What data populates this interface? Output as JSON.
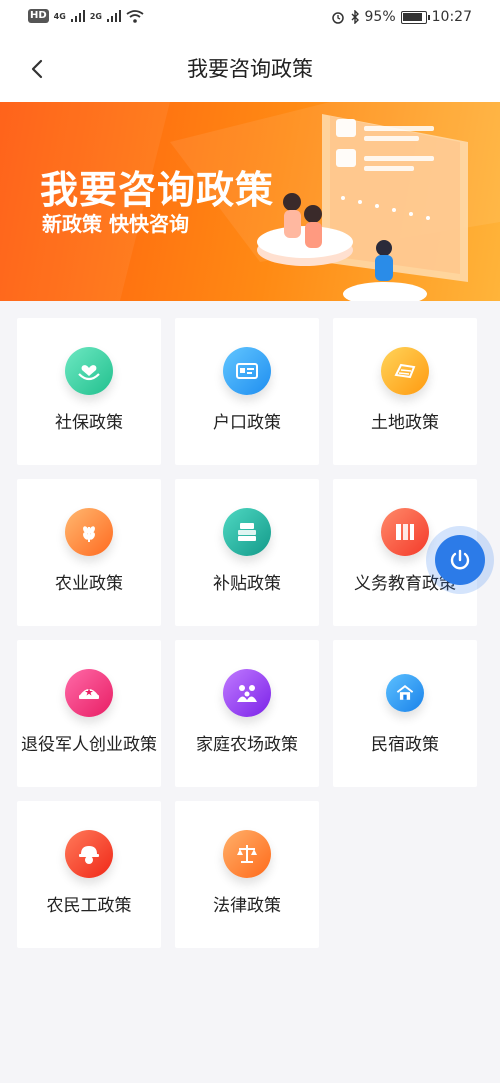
{
  "status_bar": {
    "hd": "HD",
    "net1": "4G",
    "net2": "2G",
    "battery": "95%",
    "time": "10:27"
  },
  "nav": {
    "title": "我要咨询政策"
  },
  "banner": {
    "title": "我要咨询政策",
    "subtitle": "新政策 快快咨询"
  },
  "policies": [
    {
      "label": "社保政策",
      "icon": "heart-hands-icon",
      "color": "#3fd2a0"
    },
    {
      "label": "户口政策",
      "icon": "id-card-icon",
      "color": "#2fa6f5"
    },
    {
      "label": "土地政策",
      "icon": "land-icon",
      "color": "#ffb22a"
    },
    {
      "label": "农业政策",
      "icon": "wheat-icon",
      "color": "#ff8a35"
    },
    {
      "label": "补贴政策",
      "icon": "money-stack-icon",
      "color": "#28b9a8"
    },
    {
      "label": "义务教育政策",
      "icon": "books-icon",
      "color": "#ff5a45"
    },
    {
      "label": "退役军人创业政策",
      "icon": "military-cap-icon",
      "color": "#f5307a"
    },
    {
      "label": "家庭农场政策",
      "icon": "family-icon",
      "color": "#9b3df0"
    },
    {
      "label": "民宿政策",
      "icon": "house-icon",
      "color": "#2f9cf2"
    },
    {
      "label": "农民工政策",
      "icon": "helmet-worker-icon",
      "color": "#ff4a36"
    },
    {
      "label": "法律政策",
      "icon": "scales-icon",
      "color": "#ff8030"
    }
  ]
}
